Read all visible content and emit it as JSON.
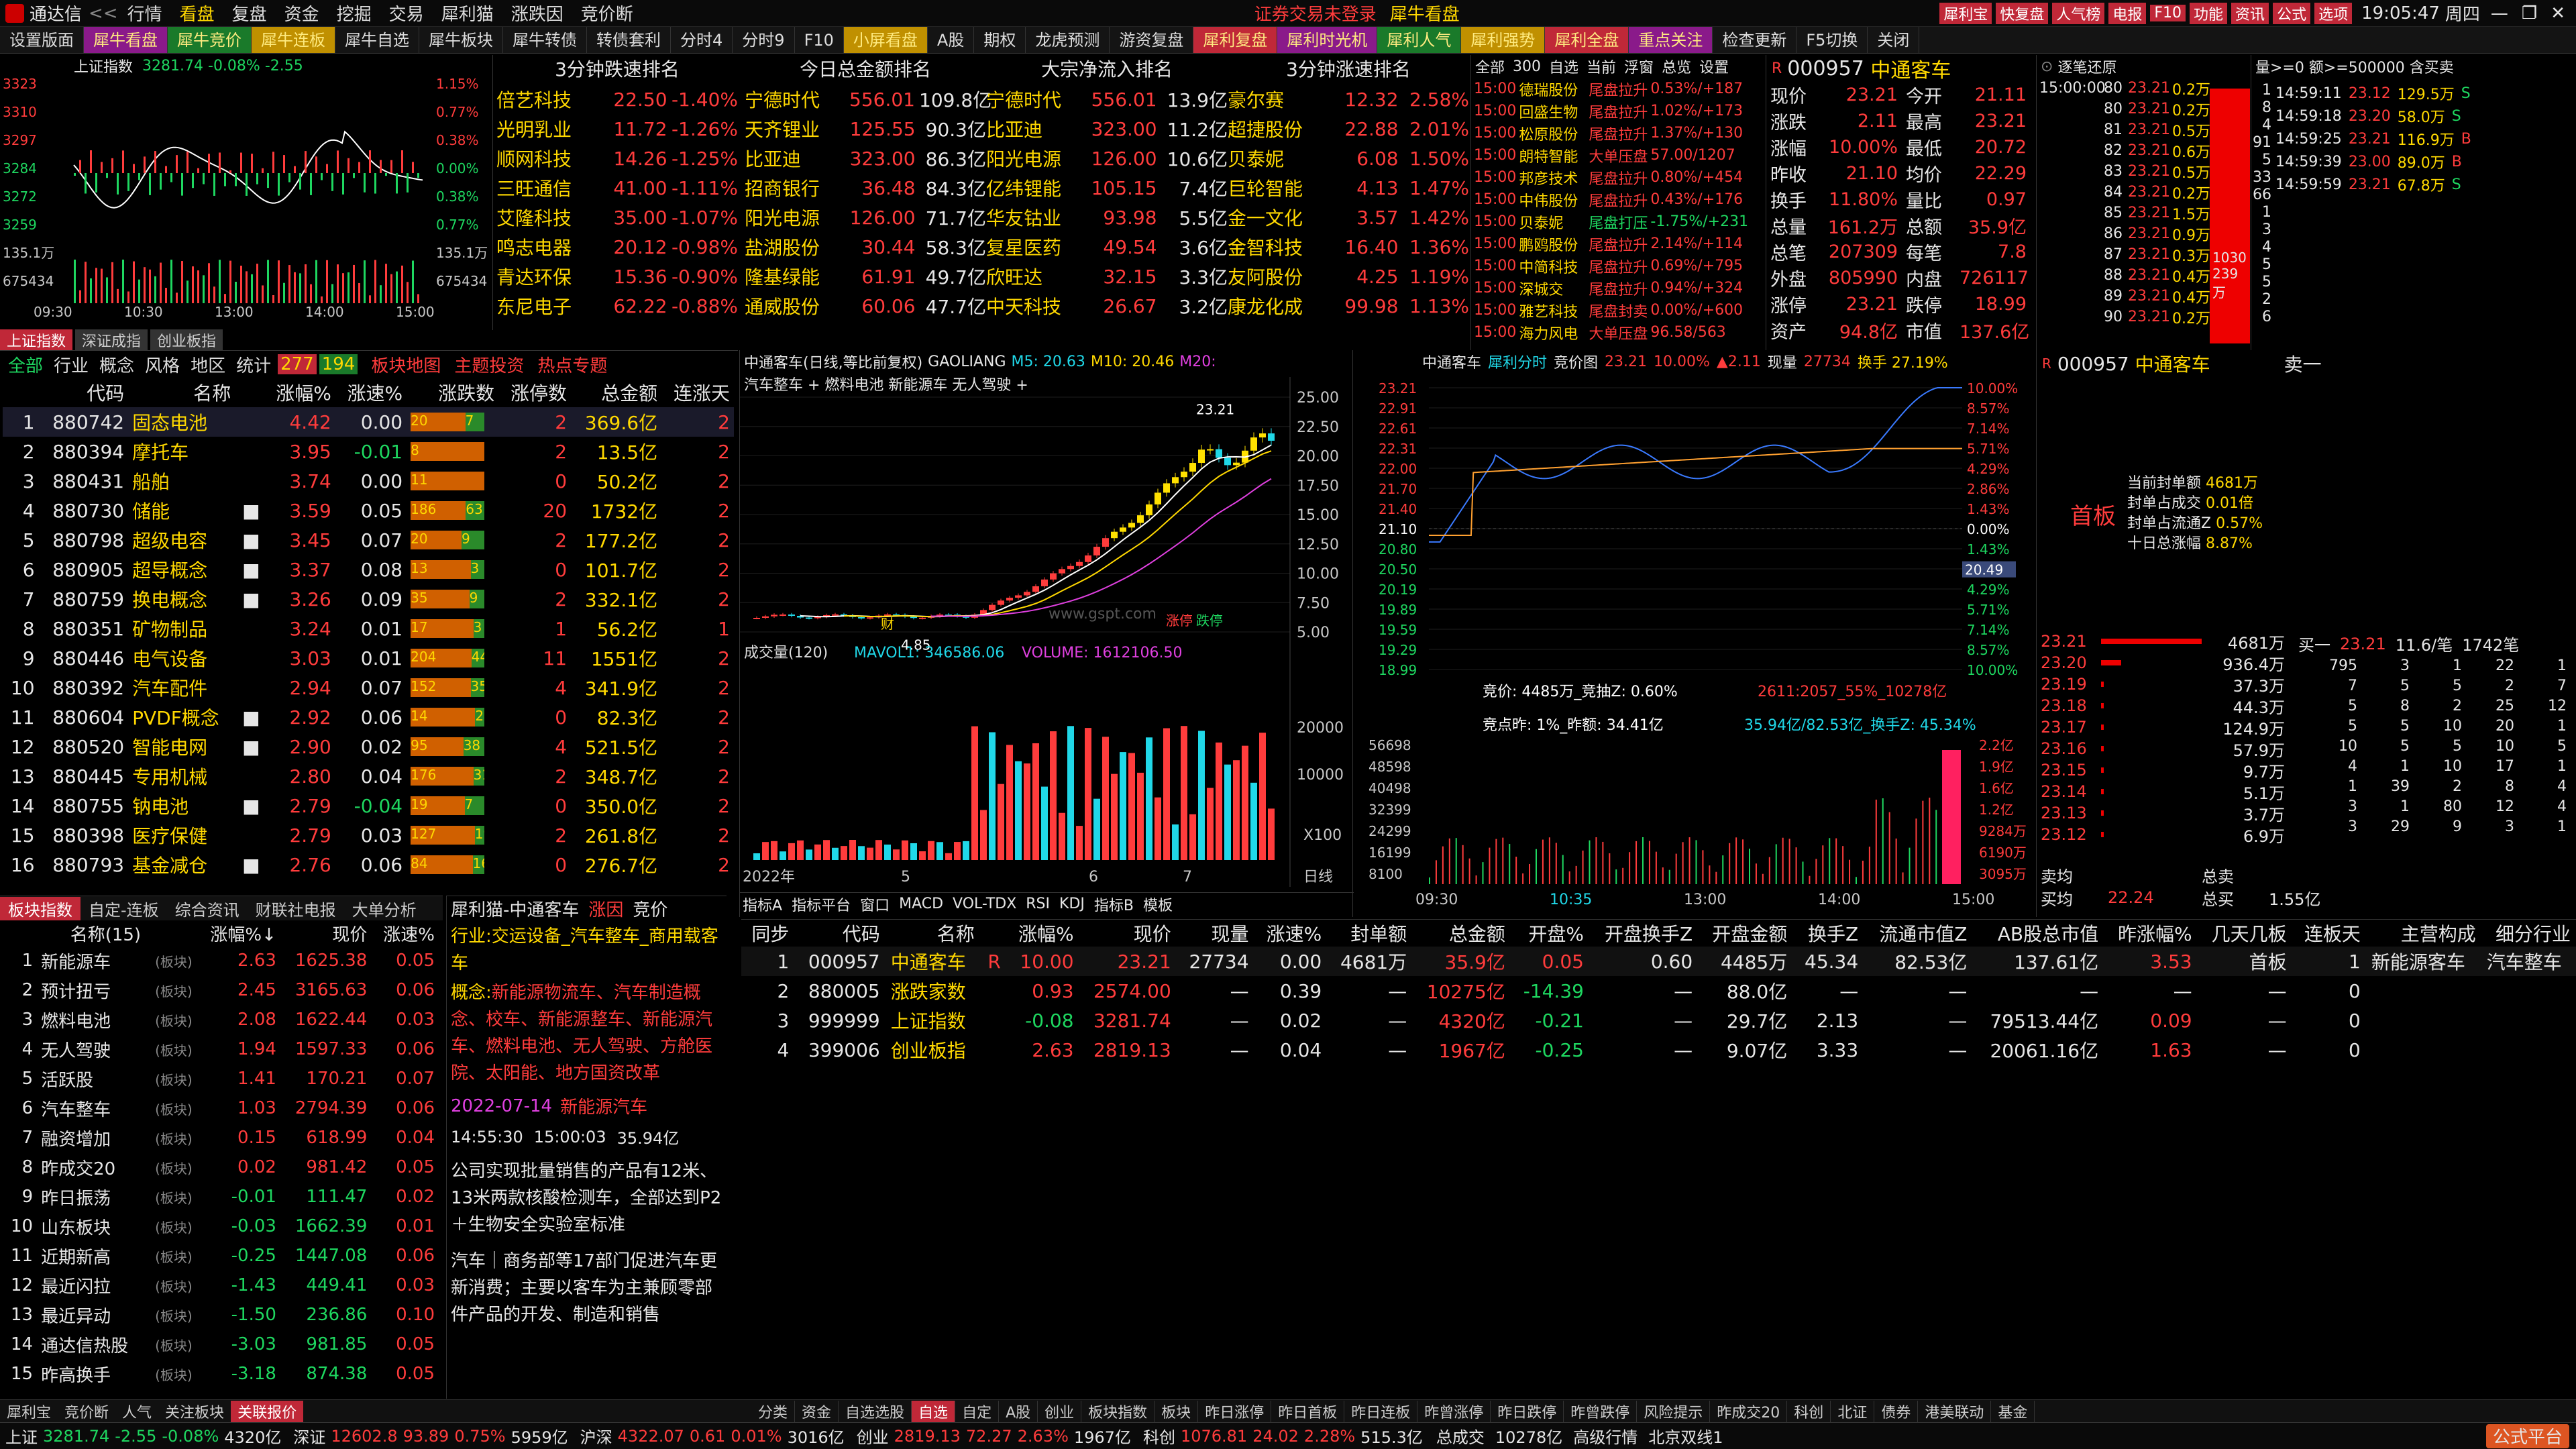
{
  "window": {
    "app_name": "通达信",
    "time": "19:05:47",
    "weekday": "周四",
    "ticker_banner": "证券交易未登录",
    "banner2": "犀牛看盘"
  },
  "menu": [
    "行情",
    "看盘",
    "复盘",
    "资金",
    "挖掘",
    "交易",
    "犀利猫",
    "涨跌因",
    "竞价断"
  ],
  "title_buttons": [
    "犀利宝",
    "快复盘",
    "人气榜",
    "电报",
    "F10",
    "功能",
    "资讯",
    "公式",
    "选项"
  ],
  "toolbar_tabs": [
    "设置版面",
    "犀牛看盘",
    "犀牛竞价",
    "犀牛连板",
    "犀牛自选",
    "犀牛板块",
    "犀牛转债",
    "转债套利",
    "分时4",
    "分时9",
    "F10",
    "小屏看盘",
    "A股",
    "期权",
    "龙虎预测",
    "游资复盘",
    "犀利复盘",
    "犀利时光机",
    "犀利人气",
    "犀利强势",
    "犀利全盘",
    "重点关注",
    "检查更新",
    "F5切换",
    "关闭"
  ],
  "index_chart": {
    "title": "上证指数",
    "value": "3281.74",
    "change": "-0.08%",
    "points": "-2.55",
    "yticks_left": [
      "3323",
      "3310",
      "3297",
      "3284",
      "3272",
      "3259",
      "135.1万",
      "675434"
    ],
    "yticks_right": [
      "1.15%",
      "0.77%",
      "0.38%",
      "0.00%",
      "0.38%",
      "0.77%",
      "135.1万",
      "675434"
    ],
    "xticks": [
      "09:30",
      "10:30",
      "13:00",
      "14:00",
      "15:00"
    ],
    "tabs": [
      "上证指数",
      "深证成指",
      "创业板指"
    ]
  },
  "fast_drop": {
    "title": "3分钟跌速排名",
    "rows": [
      [
        "倍艺科技",
        "22.50",
        "-1.40%"
      ],
      [
        "光明乳业",
        "11.72",
        "-1.26%"
      ],
      [
        "顺网科技",
        "14.26",
        "-1.25%"
      ],
      [
        "三旺通信",
        "41.00",
        "-1.11%"
      ],
      [
        "艾隆科技",
        "35.00",
        "-1.07%"
      ],
      [
        "鸣志电器",
        "20.12",
        "-0.98%"
      ],
      [
        "青达环保",
        "15.36",
        "-0.90%"
      ],
      [
        "东尼电子",
        "62.22",
        "-0.88%"
      ]
    ]
  },
  "total_amt": {
    "title": "今日总金额排名",
    "rows": [
      [
        "宁德时代",
        "556.01",
        "109.8亿"
      ],
      [
        "天齐锂业",
        "125.55",
        "90.3亿"
      ],
      [
        "比亚迪",
        "323.00",
        "86.3亿"
      ],
      [
        "招商银行",
        "36.48",
        "84.3亿"
      ],
      [
        "阳光电源",
        "126.00",
        "71.7亿"
      ],
      [
        "盐湖股份",
        "30.44",
        "58.3亿"
      ],
      [
        "隆基绿能",
        "61.91",
        "49.7亿"
      ],
      [
        "通威股份",
        "60.06",
        "47.7亿"
      ]
    ]
  },
  "net_inflow": {
    "title": "大宗净流入排名",
    "rows": [
      [
        "宁德时代",
        "556.01",
        "13.9亿"
      ],
      [
        "比亚迪",
        "323.00",
        "11.2亿"
      ],
      [
        "阳光电源",
        "126.00",
        "10.6亿"
      ],
      [
        "亿纬锂能",
        "105.15",
        "7.4亿"
      ],
      [
        "华友钴业",
        "93.98",
        "5.5亿"
      ],
      [
        "复星医药",
        "49.54",
        "3.6亿"
      ],
      [
        "欣旺达",
        "32.15",
        "3.3亿"
      ],
      [
        "中天科技",
        "26.67",
        "3.2亿"
      ]
    ]
  },
  "fast_rise": {
    "title": "3分钟涨速排名",
    "rows": [
      [
        "豪尔赛",
        "12.32",
        "2.58%"
      ],
      [
        "超捷股份",
        "22.88",
        "2.01%"
      ],
      [
        "贝泰妮",
        "6.08",
        "1.50%"
      ],
      [
        "巨轮智能",
        "4.13",
        "1.47%"
      ],
      [
        "金一文化",
        "3.57",
        "1.42%"
      ],
      [
        "金智科技",
        "16.40",
        "1.36%"
      ],
      [
        "友阿股份",
        "4.25",
        "1.19%"
      ],
      [
        "康龙化成",
        "99.98",
        "1.13%"
      ]
    ]
  },
  "alerts": {
    "header": [
      "全部",
      "300",
      "自选",
      "当前",
      "浮窗",
      "总览",
      "设置"
    ],
    "rows": [
      [
        "15:00",
        "德瑞股份",
        "尾盘拉升",
        "0.53%/+187"
      ],
      [
        "15:00",
        "回盛生物",
        "尾盘拉升",
        "1.02%/+173"
      ],
      [
        "15:00",
        "松原股份",
        "尾盘拉升",
        "1.37%/+130"
      ],
      [
        "15:00",
        "朗特智能",
        "大单压盘",
        "57.00/1207"
      ],
      [
        "15:00",
        "邦彦技术",
        "尾盘拉升",
        "0.80%/+454"
      ],
      [
        "15:00",
        "中伟股份",
        "尾盘拉升",
        "0.43%/+176"
      ],
      [
        "15:00",
        "贝泰妮",
        "尾盘打压",
        "-1.75%/+231"
      ],
      [
        "15:00",
        "鹏鸥股份",
        "尾盘拉升",
        "2.14%/+114"
      ],
      [
        "15:00",
        "中简科技",
        "尾盘拉升",
        "0.69%/+795"
      ],
      [
        "15:00",
        "深城交",
        "尾盘拉升",
        "0.94%/+324"
      ],
      [
        "15:00",
        "雅艺科技",
        "尾盘封卖",
        "0.00%/+600"
      ],
      [
        "15:00",
        "海力风电",
        "大单压盘",
        "96.58/563"
      ]
    ]
  },
  "quote": {
    "code": "000957",
    "name": "中通客车",
    "rows": [
      [
        "现价",
        "23.21",
        "今开",
        "21.11"
      ],
      [
        "涨跌",
        "2.11",
        "最高",
        "23.21"
      ],
      [
        "涨幅",
        "10.00%",
        "最低",
        "20.72"
      ],
      [
        "昨收",
        "21.10",
        "均价",
        "22.29"
      ],
      [
        "换手",
        "11.80%",
        "量比",
        "0.97"
      ],
      [
        "总量",
        "161.2万",
        "总额",
        "35.9亿"
      ],
      [
        "总笔",
        "207309",
        "每笔",
        "7.8"
      ],
      [
        "外盘",
        "805990",
        "内盘",
        "726117"
      ],
      [
        "涨停",
        "23.21",
        "跌停",
        "18.99"
      ],
      [
        "资产",
        "94.8亿",
        "市值",
        "137.6亿"
      ]
    ]
  },
  "sellqueue": {
    "title": "逐笔还原",
    "filter": "量>=0 额>=500000 含买卖",
    "rows": [
      [
        "15:00:00",
        "80",
        "23.21",
        "0.2万"
      ],
      [
        "",
        "80",
        "23.21",
        "0.2万"
      ],
      [
        "",
        "81",
        "23.21",
        "0.5万"
      ],
      [
        "",
        "82",
        "23.21",
        "0.6万"
      ],
      [
        "",
        "83",
        "23.21",
        "0.5万"
      ],
      [
        "",
        "84",
        "23.21",
        "0.2万"
      ],
      [
        "",
        "85",
        "23.21",
        "1.5万"
      ],
      [
        "",
        "86",
        "23.21",
        "0.9万"
      ],
      [
        "",
        "87",
        "23.21",
        "0.3万"
      ],
      [
        "",
        "88",
        "23.21",
        "0.4万"
      ],
      [
        "",
        "89",
        "23.21",
        "0.4万"
      ],
      [
        "",
        "90",
        "23.21",
        "0.2万"
      ]
    ],
    "side": [
      "1030",
      "239万"
    ],
    "nums": [
      "1",
      "8",
      "4",
      "91",
      "5",
      "33",
      "66",
      "1",
      "3",
      "4",
      "5",
      "5",
      "2",
      "6"
    ]
  },
  "ticks": {
    "rows": [
      [
        "14:59:11",
        "23.12",
        "129.5万",
        "S"
      ],
      [
        "14:59:18",
        "23.20",
        "58.0万",
        "S"
      ],
      [
        "14:59:25",
        "23.21",
        "116.9万",
        "B"
      ],
      [
        "14:59:39",
        "23.00",
        "89.0万",
        "B"
      ],
      [
        "14:59:59",
        "23.21",
        "67.8万",
        "S"
      ]
    ]
  },
  "sector_tabs": [
    "全部",
    "行业",
    "概念",
    "风格",
    "地区",
    "统计"
  ],
  "sector_badges": [
    "277",
    "194"
  ],
  "sector_links": [
    "板块地图",
    "主题投资",
    "热点专题"
  ],
  "sectors": {
    "headers": [
      "",
      "代码",
      "名称",
      "",
      "涨幅%",
      "涨速%",
      "涨跌数",
      "涨停数",
      "总金额",
      "连涨天"
    ],
    "rows": [
      [
        "1",
        "880742",
        "固态电池",
        "",
        "4.42",
        "0.00",
        "20",
        "7",
        "2",
        "369.6亿",
        "2"
      ],
      [
        "2",
        "880394",
        "摩托车",
        "",
        "3.95",
        "-0.01",
        "8",
        "",
        "2",
        "13.5亿",
        "2"
      ],
      [
        "3",
        "880431",
        "船舶",
        "",
        "3.74",
        "0.00",
        "11",
        "",
        "0",
        "50.2亿",
        "2"
      ],
      [
        "4",
        "880730",
        "储能",
        "■",
        "3.59",
        "0.05",
        "186",
        "63",
        "20",
        "1732亿",
        "2"
      ],
      [
        "5",
        "880798",
        "超级电容",
        "■",
        "3.45",
        "0.07",
        "20",
        "9",
        "2",
        "177.2亿",
        "2"
      ],
      [
        "6",
        "880905",
        "超导概念",
        "■",
        "3.37",
        "0.08",
        "13",
        "3",
        "0",
        "101.7亿",
        "2"
      ],
      [
        "7",
        "880759",
        "换电概念",
        "■",
        "3.26",
        "0.09",
        "35",
        "9",
        "2",
        "332.1亿",
        "2"
      ],
      [
        "8",
        "880351",
        "矿物制品",
        "",
        "3.24",
        "0.01",
        "17",
        "3",
        "1",
        "56.2亿",
        "1"
      ],
      [
        "9",
        "880446",
        "电气设备",
        "",
        "3.03",
        "0.01",
        "204",
        "44",
        "11",
        "1551亿",
        "2"
      ],
      [
        "10",
        "880392",
        "汽车配件",
        "",
        "2.94",
        "0.07",
        "152",
        "35",
        "4",
        "341.9亿",
        "2"
      ],
      [
        "11",
        "880604",
        "PVDF概念",
        "■",
        "2.92",
        "0.06",
        "14",
        "2",
        "0",
        "82.3亿",
        "2"
      ],
      [
        "12",
        "880520",
        "智能电网",
        "■",
        "2.90",
        "0.02",
        "95",
        "38",
        "4",
        "521.5亿",
        "2"
      ],
      [
        "13",
        "880445",
        "专用机械",
        "",
        "2.80",
        "0.04",
        "176",
        "31",
        "2",
        "348.7亿",
        "2"
      ],
      [
        "14",
        "880755",
        "钠电池",
        "■",
        "2.79",
        "-0.04",
        "19",
        "7",
        "0",
        "350.0亿",
        "2"
      ],
      [
        "15",
        "880398",
        "医疗保健",
        "",
        "2.79",
        "0.03",
        "127",
        "19",
        "2",
        "261.8亿",
        "2"
      ],
      [
        "16",
        "880793",
        "基金减仓",
        "■",
        "2.76",
        "0.06",
        "84",
        "16",
        "0",
        "276.7亿",
        "2"
      ]
    ]
  },
  "kline": {
    "title": "中通客车(日线,等比前复权)",
    "indicator": "GAOLIANG",
    "ma": [
      "M5: 20.63",
      "M10: 20.46",
      "M20:"
    ],
    "tags": "汽车整车 + 燃料电池 新能源车 无人驾驶 +",
    "yticks": [
      "25.00",
      "22.50",
      "20.00",
      "17.50",
      "15.00",
      "12.50",
      "10.00",
      "7.50",
      "5.00"
    ],
    "high": "23.21",
    "low": "4.85",
    "vol": {
      "title": "成交量(120)",
      "mavol": "MAVOL1: 346586.06",
      "volume": "VOLUME: 1612106.50",
      "yticks": [
        "20000",
        "10000"
      ],
      "unit": "X100"
    },
    "xticks": [
      "2022年",
      "5",
      "6",
      "7"
    ],
    "period": "日线",
    "watermark": "www.gspt.com",
    "labels": [
      "涨停",
      "跌停",
      "财"
    ],
    "bottom_tabs": [
      "指标A",
      "指标平台",
      "窗口",
      "MACD",
      "VOL-TDX",
      "RSI",
      "KDJ",
      "指标B",
      "模板"
    ]
  },
  "intraday": {
    "name": "中通客车",
    "tabs": [
      "犀利分时",
      "竞价图"
    ],
    "price": "23.21",
    "pct": "10.00%",
    "chg": "▲2.11",
    "hand": "换手 27.19%",
    "vol_label": "现量",
    "vol_val": "27734",
    "yticks_left": [
      "23.21",
      "22.91",
      "22.61",
      "22.31",
      "22.00",
      "21.70",
      "21.40",
      "21.10",
      "20.80",
      "20.50",
      "20.19",
      "19.89",
      "19.59",
      "19.29",
      "18.99"
    ],
    "yticks_right": [
      "10.00%",
      "8.57%",
      "7.14%",
      "5.71%",
      "4.29%",
      "2.86%",
      "1.43%",
      "0.00%",
      "1.43%",
      "2.86%",
      "4.29%",
      "5.71%",
      "7.14%",
      "8.57%",
      "10.00%"
    ],
    "auction": "竞价: 4485万_竞抽Z: 0.60%",
    "auction2": "2611:2057_55%_10278亿",
    "auction3": "竞点昨: 1%_昨额: 34.41亿",
    "auction4": "35.94亿/82.53亿_换手Z: 45.34%",
    "vol_yticks": [
      "56698",
      "48598",
      "40498",
      "32399",
      "24299",
      "16199",
      "8100"
    ],
    "vol_right": [
      "2.2亿",
      "1.9亿",
      "1.6亿",
      "1.2亿",
      "9284万",
      "6190万",
      "3095万"
    ],
    "xticks": [
      "09:30",
      "10:35",
      "13:00",
      "14:00",
      "15:00"
    ],
    "current": "20.49"
  },
  "orderbook": {
    "code": "000957",
    "name": "中通客车",
    "board": "首板",
    "sell_label": "卖一",
    "stats": [
      [
        "当前封单额",
        "4681万"
      ],
      [
        "封单占成交",
        "0.01倍"
      ],
      [
        "封单占流通Z",
        "0.57%"
      ],
      [
        "十日总涨幅",
        "8.87%"
      ]
    ],
    "buy_head": [
      "买一",
      "23.21",
      "11.6/笔",
      "1742笔"
    ],
    "levels": [
      [
        "23.21",
        "4681万"
      ],
      [
        "23.20",
        "936.4万"
      ],
      [
        "23.19",
        "37.3万"
      ],
      [
        "23.18",
        "44.3万"
      ],
      [
        "23.17",
        "124.9万"
      ],
      [
        "23.16",
        "57.9万"
      ],
      [
        "23.15",
        "9.7万"
      ],
      [
        "23.14",
        "5.1万"
      ],
      [
        "23.13",
        "3.7万"
      ],
      [
        "23.12",
        "6.9万"
      ]
    ],
    "queue": [
      [
        "795",
        "3",
        "1",
        "22",
        "1"
      ],
      [
        "7",
        "5",
        "5",
        "2",
        "7"
      ],
      [
        "5",
        "8",
        "2",
        "25",
        "12"
      ],
      [
        "5",
        "5",
        "10",
        "20",
        "1"
      ],
      [
        "10",
        "5",
        "5",
        "10",
        "5"
      ],
      [
        "4",
        "1",
        "10",
        "17",
        "1"
      ],
      [
        "1",
        "39",
        "2",
        "8",
        "4"
      ],
      [
        "3",
        "1",
        "80",
        "12",
        "4"
      ],
      [
        "3",
        "29",
        "9",
        "3",
        "1"
      ]
    ],
    "footer": [
      [
        "卖均",
        "",
        "总卖",
        ""
      ],
      [
        "买均",
        "22.24",
        "总买",
        "1.55亿"
      ]
    ]
  },
  "index_tabs": [
    "板块指数",
    "自定-连板",
    "综合资讯",
    "财联社电报",
    "大单分析"
  ],
  "index_list": {
    "headers": [
      "",
      "名称(15)",
      "",
      "涨幅%↓",
      "现价",
      "涨速%"
    ],
    "rows": [
      [
        "1",
        "新能源车",
        "(板块)",
        "2.63",
        "1625.38",
        "0.05"
      ],
      [
        "2",
        "预计扭亏",
        "(板块)",
        "2.45",
        "3165.63",
        "0.06"
      ],
      [
        "3",
        "燃料电池",
        "(板块)",
        "2.08",
        "1622.44",
        "0.03"
      ],
      [
        "4",
        "无人驾驶",
        "(板块)",
        "1.94",
        "1597.33",
        "0.06"
      ],
      [
        "5",
        "活跃股",
        "(板块)",
        "1.41",
        "170.21",
        "0.07"
      ],
      [
        "6",
        "汽车整车",
        "(板块)",
        "1.03",
        "2794.39",
        "0.06"
      ],
      [
        "7",
        "融资增加",
        "(板块)",
        "0.15",
        "618.99",
        "0.04"
      ],
      [
        "8",
        "昨成交20",
        "(板块)",
        "0.02",
        "981.42",
        "0.05"
      ],
      [
        "9",
        "昨日振荡",
        "(板块)",
        "-0.01",
        "111.47",
        "0.02"
      ],
      [
        "10",
        "山东板块",
        "(板块)",
        "-0.03",
        "1662.39",
        "0.01"
      ],
      [
        "11",
        "近期新高",
        "(板块)",
        "-0.25",
        "1447.08",
        "0.06"
      ],
      [
        "12",
        "最近闪拉",
        "(板块)",
        "-1.43",
        "449.41",
        "0.03"
      ],
      [
        "13",
        "最近异动",
        "(板块)",
        "-1.50",
        "236.86",
        "0.10"
      ],
      [
        "14",
        "通达信热股",
        "(板块)",
        "-3.03",
        "981.85",
        "0.05"
      ],
      [
        "15",
        "昨高换手",
        "(板块)",
        "-3.18",
        "874.38",
        "0.05"
      ]
    ]
  },
  "info_panel": {
    "title": "犀利猫-中通客车",
    "tabs": [
      "涨因",
      "竞价"
    ],
    "industry_label": "行业:",
    "industry": "交运设备_汽车整车_商用载客车",
    "concept_label": "概念:",
    "concepts": "新能源物流车、汽车制造概念、校车、新能源整车、新能源汽车、燃料电池、无人驾驶、方舱医院、太阳能、地方国资改革",
    "date": "2022-07-14",
    "tag": "新能源汽车",
    "t1": "14:55:30",
    "t2": "15:00:03",
    "amt": "35.94亿",
    "news1": "公司实现批量销售的产品有12米、13米两款核酸检测车，全部达到P2＋生物安全实验室标准",
    "news2": "汽车｜商务部等17部门促进汽车更新消费；主要以客车为主兼顾零部件产品的开发、制造和销售"
  },
  "watch": {
    "headers": [
      "同步",
      "代码",
      "名称",
      "",
      "涨幅%",
      "现价",
      "现量",
      "涨速%",
      "封单额",
      "总金额",
      "开盘%",
      "开盘换手Z",
      "开盘金额",
      "换手Z",
      "流通市值Z",
      "AB股总市值",
      "昨涨幅%",
      "几天几板",
      "连板天",
      "主营构成",
      "细分行业"
    ],
    "rows": [
      [
        "1",
        "000957",
        "中通客车",
        "R",
        "10.00",
        "23.21",
        "27734",
        "0.00",
        "4681万",
        "35.9亿",
        "0.05",
        "0.60",
        "4485万",
        "45.34",
        "82.53亿",
        "137.61亿",
        "3.53",
        "首板",
        "1",
        "新能源客车",
        "汽车整车"
      ],
      [
        "2",
        "880005",
        "涨跌家数",
        "",
        "0.93",
        "2574.00",
        "—",
        "0.39",
        "—",
        "10275亿",
        "-14.39",
        "—",
        "88.0亿",
        "—",
        "—",
        "—",
        "—",
        "—",
        "0",
        "",
        ""
      ],
      [
        "3",
        "999999",
        "上证指数",
        "",
        "-0.08",
        "3281.74",
        "—",
        "0.02",
        "—",
        "4320亿",
        "-0.21",
        "—",
        "29.7亿",
        "2.13",
        "—",
        "79513.44亿",
        "0.09",
        "—",
        "0",
        "",
        ""
      ],
      [
        "4",
        "399006",
        "创业板指",
        "",
        "2.63",
        "2819.13",
        "—",
        "0.04",
        "—",
        "1967亿",
        "-0.25",
        "—",
        "9.07亿",
        "3.33",
        "—",
        "20061.16亿",
        "1.63",
        "—",
        "0",
        "",
        ""
      ]
    ]
  },
  "bottom_tabs_left": [
    "犀利宝",
    "竞价断",
    "人气",
    "关注板块",
    "关联报价"
  ],
  "bottom_tabs_right": [
    "分类",
    "资金",
    "自选选股",
    "自选",
    "自定",
    "A股",
    "创业",
    "板块指数",
    "板块",
    "昨日涨停",
    "昨日首板",
    "昨日连板",
    "昨曾涨停",
    "昨日跌停",
    "昨曾跌停",
    "风险提示",
    "昨成交20",
    "科创",
    "北证",
    "债券",
    "港美联动",
    "基金"
  ],
  "status": {
    "items": [
      [
        "上证",
        "3281.74",
        "-2.55",
        "-0.08%",
        "4320亿"
      ],
      [
        "深证",
        "12602.8",
        "93.89",
        "0.75%",
        "5959亿"
      ],
      [
        "沪深",
        "4322.07",
        "0.61",
        "0.01%",
        "3016亿"
      ],
      [
        "创业",
        "2819.13",
        "72.27",
        "2.63%",
        "1967亿"
      ],
      [
        "科创",
        "1076.81",
        "24.02",
        "2.28%",
        "515.3亿"
      ]
    ],
    "extra": [
      "总成交",
      "10278亿",
      "高级行情",
      "北京双线1"
    ],
    "logo": "公式平台",
    "logo_url": "www.gspt.com"
  }
}
